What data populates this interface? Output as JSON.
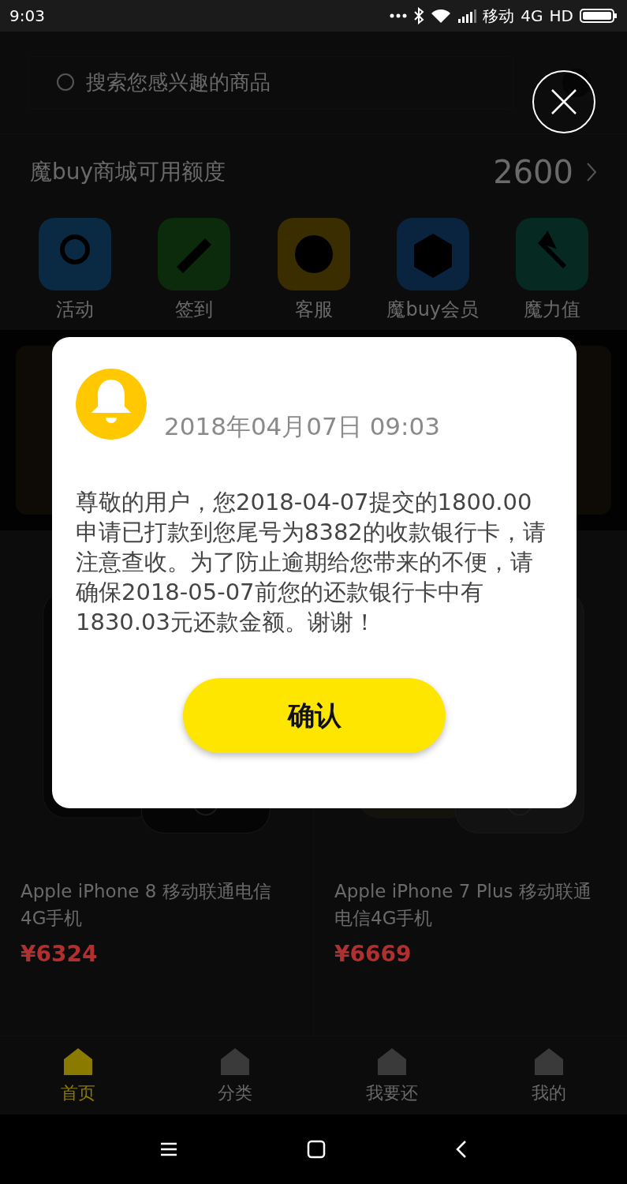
{
  "status_bar": {
    "time": "9:03",
    "carrier": "移动",
    "network": "4G",
    "hd": "HD"
  },
  "search": {
    "placeholder": "搜索您感兴趣的商品"
  },
  "credit": {
    "label": "魔buy商城可用额度",
    "amount": "2600"
  },
  "shortcuts": [
    {
      "label": "活动",
      "color": "#0a2a44"
    },
    {
      "label": "签到",
      "color": "#0c2a0c"
    },
    {
      "label": "客服",
      "color": "#3a2e00"
    },
    {
      "label": "魔buy会员",
      "color": "#0a2440"
    },
    {
      "label": "魔力值",
      "color": "#062a22"
    }
  ],
  "products": [
    {
      "title": "Apple iPhone 8 移动联通电信4G手机",
      "price": "¥6324"
    },
    {
      "title": "Apple iPhone 7 Plus 移动联通电信4G手机",
      "price": "¥6669"
    }
  ],
  "tab_bar": [
    {
      "label": "首页",
      "selected": true
    },
    {
      "label": "分类",
      "selected": false
    },
    {
      "label": "我要还",
      "selected": false
    },
    {
      "label": "我的",
      "selected": false
    }
  ],
  "dialog": {
    "date": "2018年04月07日 09:03",
    "message": "尊敬的用户，您2018-04-07提交的1800.00申请已打款到您尾号为8382的收款银行卡，请注意查收。为了防止逾期给您带来的不便，请确保2018-05-07前您的还款银行卡中有1830.03元还款金额。谢谢！",
    "confirm": "确认"
  }
}
